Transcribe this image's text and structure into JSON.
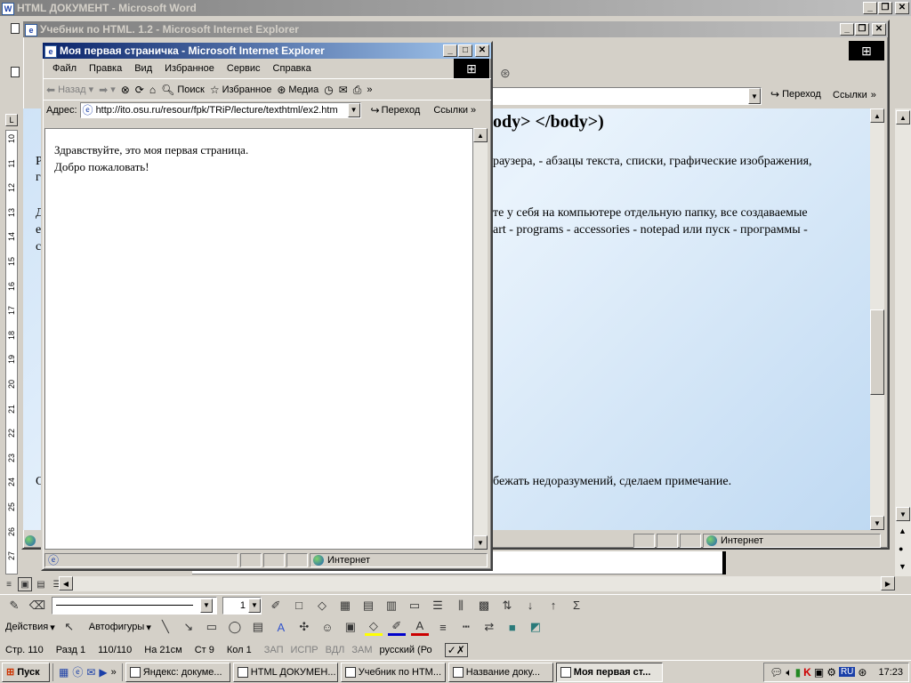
{
  "word": {
    "title": "HTML ДОКУМЕНТ - Microsoft Word",
    "left_ruler": [
      "10",
      "11",
      "12",
      "13",
      "14",
      "15",
      "16",
      "17",
      "18",
      "19",
      "20",
      "21",
      "22",
      "23",
      "24",
      "25",
      "26",
      "27"
    ],
    "drawing": {
      "actions": "Действия",
      "autoshapes": "Автофигуры"
    },
    "toolbar": {
      "line_width": "1"
    },
    "status": {
      "page": "Стр. 110",
      "section": "Разд 1",
      "pages": "110/110",
      "at": "На 21см",
      "line": "Ст 9",
      "col": "Кол 1",
      "rec": "ЗАП",
      "trk": "ИСПР",
      "ext": "ВДЛ",
      "ovr": "ЗАМ",
      "lang": "русский (Ро"
    }
  },
  "ie_back": {
    "title": "Учебник по HTML. 1.2 - Microsoft Internet Explorer",
    "go": "Переход",
    "links": "Ссылки",
    "heading_fragment": "ody> </body>)",
    "para1": "раузера, - абзацы текста, списки, графические изображения,",
    "para2": "те у себя на компьютере отдельную папку, все создаваемые",
    "para3": "art - programs - accessories - notepad или пуск - программы -",
    "para4": "бежать недоразумений, сделаем примечание.",
    "zone": "Интернет",
    "left_fragments": [
      "Р",
      "г",
      "Д",
      "е",
      "с",
      "С"
    ]
  },
  "ie_front": {
    "title": "Моя первая страничка - Microsoft Internet Explorer",
    "menu": [
      "Файл",
      "Правка",
      "Вид",
      "Избранное",
      "Сервис",
      "Справка"
    ],
    "toolbar": {
      "back": "Назад",
      "search": "Поиск",
      "favorites": "Избранное",
      "media": "Медиа"
    },
    "address_label": "Адрес:",
    "address": "http://ito.osu.ru/resour/fpk/TRiP/lecture/texthtml/ex2.htm",
    "go": "Переход",
    "links": "Ссылки",
    "page_line1": "Здравствуйте, это моя первая страница.",
    "page_line2": "Добро пожаловать!",
    "zone": "Интернет"
  },
  "taskbar": {
    "start": "Пуск",
    "tasks": [
      "Яндекс: докуме...",
      "HTML ДОКУМЕН...",
      "Учебник по HTM...",
      "Название доку...",
      "Моя первая ст..."
    ],
    "active_index": 4,
    "tray_lang": "RU",
    "clock": "17:23"
  }
}
